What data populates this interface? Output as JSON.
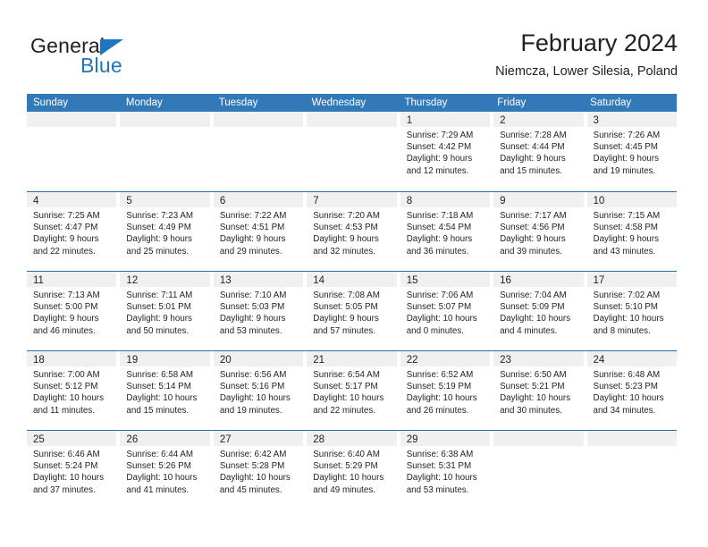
{
  "logo": {
    "text_primary": "General",
    "text_secondary": "Blue",
    "triangle_color": "#2175bc"
  },
  "header": {
    "title": "February 2024",
    "subtitle": "Niemcza, Lower Silesia, Poland"
  },
  "theme": {
    "header_blue": "#3279ba",
    "row_border_blue": "#2e6da4",
    "daynum_band": "#f0f0f0",
    "text": "#231f20"
  },
  "calendar": {
    "weekday_headers": [
      "Sunday",
      "Monday",
      "Tuesday",
      "Wednesday",
      "Thursday",
      "Friday",
      "Saturday"
    ],
    "weeks": [
      [
        {
          "day": "",
          "lines": []
        },
        {
          "day": "",
          "lines": []
        },
        {
          "day": "",
          "lines": []
        },
        {
          "day": "",
          "lines": []
        },
        {
          "day": "1",
          "lines": [
            "Sunrise: 7:29 AM",
            "Sunset: 4:42 PM",
            "Daylight: 9 hours",
            "and 12 minutes."
          ]
        },
        {
          "day": "2",
          "lines": [
            "Sunrise: 7:28 AM",
            "Sunset: 4:44 PM",
            "Daylight: 9 hours",
            "and 15 minutes."
          ]
        },
        {
          "day": "3",
          "lines": [
            "Sunrise: 7:26 AM",
            "Sunset: 4:45 PM",
            "Daylight: 9 hours",
            "and 19 minutes."
          ]
        }
      ],
      [
        {
          "day": "4",
          "lines": [
            "Sunrise: 7:25 AM",
            "Sunset: 4:47 PM",
            "Daylight: 9 hours",
            "and 22 minutes."
          ]
        },
        {
          "day": "5",
          "lines": [
            "Sunrise: 7:23 AM",
            "Sunset: 4:49 PM",
            "Daylight: 9 hours",
            "and 25 minutes."
          ]
        },
        {
          "day": "6",
          "lines": [
            "Sunrise: 7:22 AM",
            "Sunset: 4:51 PM",
            "Daylight: 9 hours",
            "and 29 minutes."
          ]
        },
        {
          "day": "7",
          "lines": [
            "Sunrise: 7:20 AM",
            "Sunset: 4:53 PM",
            "Daylight: 9 hours",
            "and 32 minutes."
          ]
        },
        {
          "day": "8",
          "lines": [
            "Sunrise: 7:18 AM",
            "Sunset: 4:54 PM",
            "Daylight: 9 hours",
            "and 36 minutes."
          ]
        },
        {
          "day": "9",
          "lines": [
            "Sunrise: 7:17 AM",
            "Sunset: 4:56 PM",
            "Daylight: 9 hours",
            "and 39 minutes."
          ]
        },
        {
          "day": "10",
          "lines": [
            "Sunrise: 7:15 AM",
            "Sunset: 4:58 PM",
            "Daylight: 9 hours",
            "and 43 minutes."
          ]
        }
      ],
      [
        {
          "day": "11",
          "lines": [
            "Sunrise: 7:13 AM",
            "Sunset: 5:00 PM",
            "Daylight: 9 hours",
            "and 46 minutes."
          ]
        },
        {
          "day": "12",
          "lines": [
            "Sunrise: 7:11 AM",
            "Sunset: 5:01 PM",
            "Daylight: 9 hours",
            "and 50 minutes."
          ]
        },
        {
          "day": "13",
          "lines": [
            "Sunrise: 7:10 AM",
            "Sunset: 5:03 PM",
            "Daylight: 9 hours",
            "and 53 minutes."
          ]
        },
        {
          "day": "14",
          "lines": [
            "Sunrise: 7:08 AM",
            "Sunset: 5:05 PM",
            "Daylight: 9 hours",
            "and 57 minutes."
          ]
        },
        {
          "day": "15",
          "lines": [
            "Sunrise: 7:06 AM",
            "Sunset: 5:07 PM",
            "Daylight: 10 hours",
            "and 0 minutes."
          ]
        },
        {
          "day": "16",
          "lines": [
            "Sunrise: 7:04 AM",
            "Sunset: 5:09 PM",
            "Daylight: 10 hours",
            "and 4 minutes."
          ]
        },
        {
          "day": "17",
          "lines": [
            "Sunrise: 7:02 AM",
            "Sunset: 5:10 PM",
            "Daylight: 10 hours",
            "and 8 minutes."
          ]
        }
      ],
      [
        {
          "day": "18",
          "lines": [
            "Sunrise: 7:00 AM",
            "Sunset: 5:12 PM",
            "Daylight: 10 hours",
            "and 11 minutes."
          ]
        },
        {
          "day": "19",
          "lines": [
            "Sunrise: 6:58 AM",
            "Sunset: 5:14 PM",
            "Daylight: 10 hours",
            "and 15 minutes."
          ]
        },
        {
          "day": "20",
          "lines": [
            "Sunrise: 6:56 AM",
            "Sunset: 5:16 PM",
            "Daylight: 10 hours",
            "and 19 minutes."
          ]
        },
        {
          "day": "21",
          "lines": [
            "Sunrise: 6:54 AM",
            "Sunset: 5:17 PM",
            "Daylight: 10 hours",
            "and 22 minutes."
          ]
        },
        {
          "day": "22",
          "lines": [
            "Sunrise: 6:52 AM",
            "Sunset: 5:19 PM",
            "Daylight: 10 hours",
            "and 26 minutes."
          ]
        },
        {
          "day": "23",
          "lines": [
            "Sunrise: 6:50 AM",
            "Sunset: 5:21 PM",
            "Daylight: 10 hours",
            "and 30 minutes."
          ]
        },
        {
          "day": "24",
          "lines": [
            "Sunrise: 6:48 AM",
            "Sunset: 5:23 PM",
            "Daylight: 10 hours",
            "and 34 minutes."
          ]
        }
      ],
      [
        {
          "day": "25",
          "lines": [
            "Sunrise: 6:46 AM",
            "Sunset: 5:24 PM",
            "Daylight: 10 hours",
            "and 37 minutes."
          ]
        },
        {
          "day": "26",
          "lines": [
            "Sunrise: 6:44 AM",
            "Sunset: 5:26 PM",
            "Daylight: 10 hours",
            "and 41 minutes."
          ]
        },
        {
          "day": "27",
          "lines": [
            "Sunrise: 6:42 AM",
            "Sunset: 5:28 PM",
            "Daylight: 10 hours",
            "and 45 minutes."
          ]
        },
        {
          "day": "28",
          "lines": [
            "Sunrise: 6:40 AM",
            "Sunset: 5:29 PM",
            "Daylight: 10 hours",
            "and 49 minutes."
          ]
        },
        {
          "day": "29",
          "lines": [
            "Sunrise: 6:38 AM",
            "Sunset: 5:31 PM",
            "Daylight: 10 hours",
            "and 53 minutes."
          ]
        },
        {
          "day": "",
          "lines": []
        },
        {
          "day": "",
          "lines": []
        }
      ]
    ]
  }
}
